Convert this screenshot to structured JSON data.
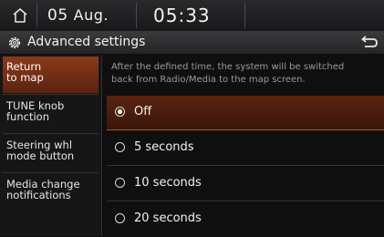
{
  "status": {
    "day": "05",
    "month": "Aug.",
    "time": "05:33"
  },
  "header": {
    "title": "Advanced settings"
  },
  "sidebar": {
    "items": [
      {
        "line1": "Return",
        "line2": "to map",
        "active": true
      },
      {
        "line1": "TUNE knob",
        "line2": "function",
        "active": false
      },
      {
        "line1": "Steering whl",
        "line2": "mode button",
        "active": false
      },
      {
        "line1": "Media change",
        "line2": "notifications",
        "active": false
      }
    ]
  },
  "main": {
    "description_line1": "After the defined time, the system will be switched",
    "description_line2": "back from Radio/Media to the map screen.",
    "options": [
      {
        "label": "Off",
        "selected": true
      },
      {
        "label": "5 seconds",
        "selected": false
      },
      {
        "label": "10 seconds",
        "selected": false
      },
      {
        "label": "20 seconds",
        "selected": false
      }
    ]
  },
  "colors": {
    "accent": "#b5541e",
    "active_bg": "#8a3a1a",
    "background": "#0f0f10"
  },
  "icons": {
    "home": "home-icon",
    "settings": "gear-icon",
    "back": "back-arrow-icon"
  }
}
